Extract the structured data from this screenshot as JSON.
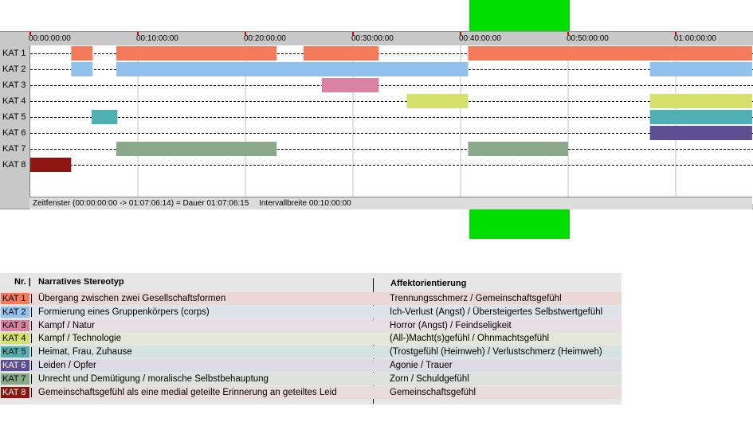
{
  "colors": {
    "marker": "#00dd00",
    "kat1": "#f47a5c",
    "kat2": "#93c1ee",
    "kat3": "#d883a3",
    "kat4": "#d4e06a",
    "kat5": "#4eb0b0",
    "kat6": "#5e4f93",
    "kat7": "#8aa88a",
    "kat8": "#8b1510"
  },
  "timeline": {
    "categories": [
      "KAT 1",
      "KAT 2",
      "KAT 3",
      "KAT 4",
      "KAT 5",
      "KAT 6",
      "KAT 7",
      "KAT 8"
    ],
    "ticks": [
      "00:00:00:00",
      "00:10:00:00",
      "00:20:00:00",
      "00:30:00:00",
      "00:40:00:00",
      "00:50:00:00",
      "01:00:00:00"
    ],
    "range_min": [
      0,
      67.104
    ],
    "status_range": "Zeitfenster (00:00:00:00 -> 01:07:06:14) = Dauer 01:07:06:15",
    "status_interval": "Intervallbreite 00:10:00:00",
    "marker_range_min": [
      40.7,
      50.0
    ],
    "segments": [
      {
        "kat": 1,
        "start": 3.8,
        "end": 5.8
      },
      {
        "kat": 1,
        "start": 8.0,
        "end": 22.9
      },
      {
        "kat": 1,
        "start": 25.4,
        "end": 32.4
      },
      {
        "kat": 1,
        "start": 40.7,
        "end": 67.104
      },
      {
        "kat": 2,
        "start": 3.8,
        "end": 5.8
      },
      {
        "kat": 2,
        "start": 8.0,
        "end": 40.7
      },
      {
        "kat": 2,
        "start": 57.6,
        "end": 67.104
      },
      {
        "kat": 3,
        "start": 27.1,
        "end": 32.4
      },
      {
        "kat": 4,
        "start": 35.0,
        "end": 40.7
      },
      {
        "kat": 4,
        "start": 57.6,
        "end": 67.104
      },
      {
        "kat": 5,
        "start": 5.7,
        "end": 8.1
      },
      {
        "kat": 5,
        "start": 57.6,
        "end": 67.104
      },
      {
        "kat": 6,
        "start": 57.6,
        "end": 67.104
      },
      {
        "kat": 7,
        "start": 8.0,
        "end": 22.9
      },
      {
        "kat": 7,
        "start": 40.7,
        "end": 50.0
      },
      {
        "kat": 8,
        "start": 0.0,
        "end": 3.8
      }
    ]
  },
  "legend": {
    "header_nr": "Nr. |",
    "header_stereotyp": "Narratives Stereotyp",
    "header_affekt": "Affektorientierung",
    "rows": [
      {
        "kat": "KAT 1",
        "stereotyp": "Übergang zwischen zwei Gesellschaftsformen",
        "affekt": "Trennungsschmerz / Gemeinschaftsgefühl",
        "bg": "#ebd8d4"
      },
      {
        "kat": "KAT 2",
        "stereotyp": "Formierung eines Gruppenkörpers (corps)",
        "affekt": "Ich-Verlust (Angst) / Übersteigertes Selbstwertgefühl",
        "bg": "#dee3ea"
      },
      {
        "kat": "KAT 3",
        "stereotyp": "Kampf / Natur",
        "affekt": "Horror (Angst) / Feindseligkeit",
        "bg": "#e8dde2"
      },
      {
        "kat": "KAT 4",
        "stereotyp": "Kampf / Technologie",
        "affekt": "(All-)Macht(s)gefühl / Ohnmachtsgefühl",
        "bg": "#e4e6d8"
      },
      {
        "kat": "KAT 5",
        "stereotyp": "Heimat, Frau, Zuhause",
        "affekt": "(Trostgefühl (Heimweh) / Verlustschmerz (Heimweh)",
        "bg": "#d6e3e2"
      },
      {
        "kat": "KAT 6",
        "stereotyp": "Leiden / Opfer",
        "affekt": "Agonie / Trauer",
        "bg": "#dcdae2"
      },
      {
        "kat": "KAT 7",
        "stereotyp": "Unrecht und Demütigung / moralische Selbstbehauptung",
        "affekt": "Zorn / Schuldgefühl",
        "bg": "#dde2dd"
      },
      {
        "kat": "KAT 8",
        "stereotyp": "Gemeinschaftsgefühl als eine medial geteilte Erinnerung an geteiltes Leid",
        "affekt": "Gemeinschaftsgefühl",
        "bg": "#e9dcdc"
      }
    ]
  }
}
